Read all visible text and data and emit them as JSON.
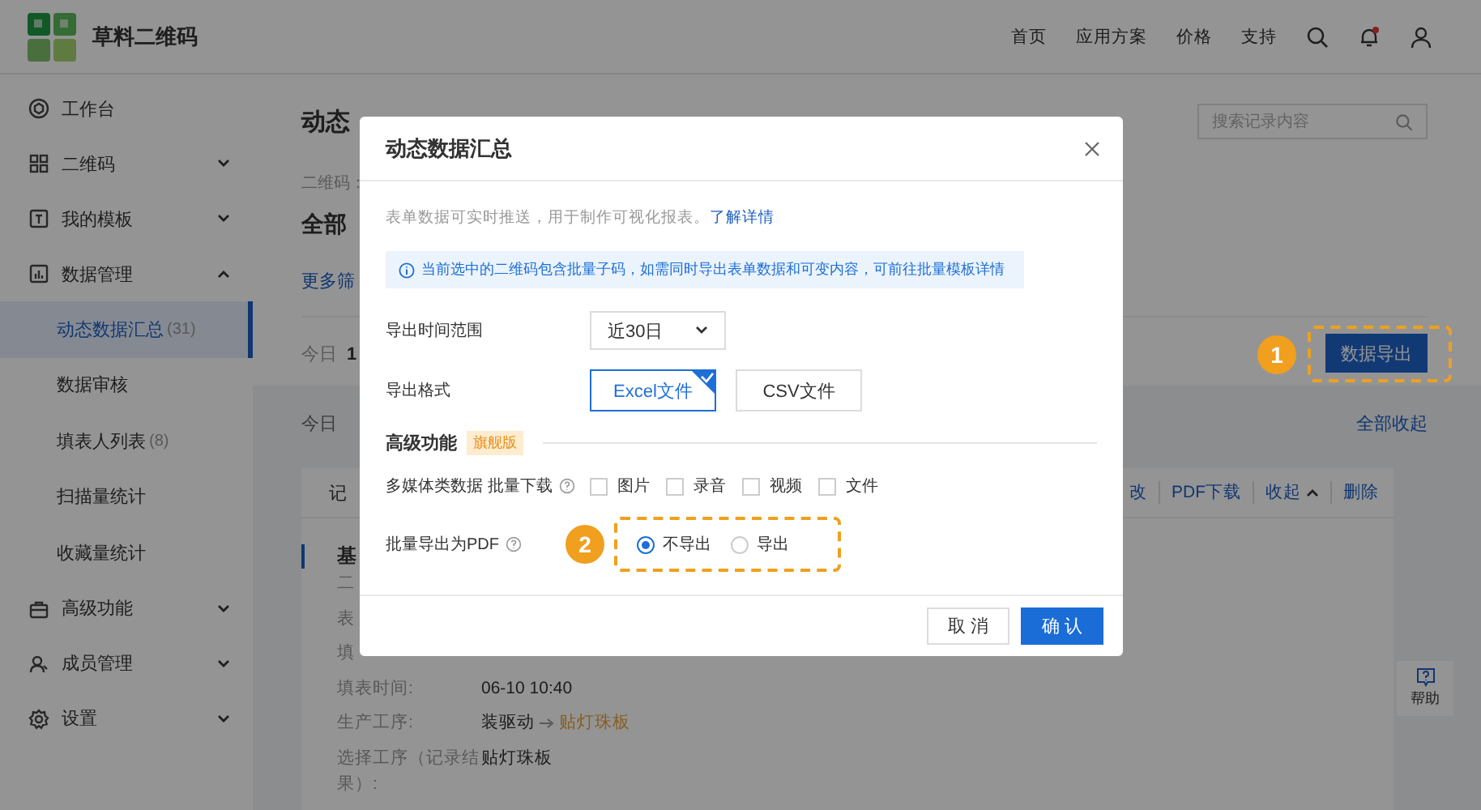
{
  "header": {
    "brand": "草料二维码",
    "nav": [
      "首页",
      "应用方案",
      "价格",
      "支持"
    ]
  },
  "sidebar": {
    "items": [
      {
        "kind": "link",
        "label": "工作台"
      },
      {
        "kind": "group",
        "label": "二维码",
        "expanded": false
      },
      {
        "kind": "group",
        "label": "我的模板",
        "expanded": false
      },
      {
        "kind": "group",
        "label": "数据管理",
        "expanded": true,
        "children": [
          {
            "label": "动态数据汇总",
            "count": "(31)",
            "selected": true
          },
          {
            "label": "数据审核",
            "selected": false
          },
          {
            "label": "填表人列表",
            "count": "(8)",
            "selected": false
          },
          {
            "label": "扫描量统计",
            "selected": false
          },
          {
            "label": "收藏量统计",
            "selected": false
          }
        ]
      },
      {
        "kind": "group",
        "label": "高级功能",
        "expanded": false
      },
      {
        "kind": "group",
        "label": "成员管理",
        "expanded": false
      },
      {
        "kind": "group",
        "label": "设置",
        "expanded": false
      }
    ]
  },
  "page": {
    "title": "动态",
    "search": {
      "placeholder": "搜索记录内容"
    },
    "qr_label": "二维码：",
    "qr_name": "全部",
    "filter_link": "更多筛",
    "today_label": "今日",
    "today_count": "1",
    "export_button": "数据导出",
    "section_label": "今日",
    "collapse_all": "全部收起",
    "record": {
      "header": "记",
      "actions": [
        {
          "label": "改",
          "kind": "link"
        },
        {
          "label": "PDF下载",
          "kind": "link"
        },
        {
          "label": "收起",
          "kind": "dropdown"
        },
        {
          "label": "删除",
          "kind": "link"
        }
      ],
      "section_title": "基",
      "fields": [
        {
          "label": "二"
        },
        {
          "label": "表"
        },
        {
          "label": "填"
        },
        {
          "label": "填表时间:",
          "value": "06-10 10:40"
        },
        {
          "label": "生产工序:",
          "steps": [
            {
              "text": "装驱动",
              "current": false
            },
            {
              "text": "贴灯珠板",
              "current": true
            }
          ]
        },
        {
          "label": "选择工序（记录结果）:",
          "value": "贴灯珠板"
        }
      ]
    }
  },
  "help": {
    "label": "帮助"
  },
  "dialog": {
    "title": "动态数据汇总",
    "intro": "表单数据可实时推送，用于制作可视化报表。",
    "intro_link": "了解详情",
    "notice": "当前选中的二维码包含批量子码，如需同时导出表单数据和可变内容，可前往批量模板详情",
    "time_range": {
      "label": "导出时间范围",
      "value": "近30日"
    },
    "format": {
      "label": "导出格式",
      "options": [
        {
          "label": "Excel文件",
          "selected": true
        },
        {
          "label": "CSV文件",
          "selected": false
        }
      ]
    },
    "advanced": {
      "title": "高级功能",
      "badge": "旗舰版"
    },
    "media": {
      "label": "多媒体类数据 批量下载",
      "options": [
        {
          "label": "图片",
          "checked": false
        },
        {
          "label": "录音",
          "checked": false
        },
        {
          "label": "视频",
          "checked": false
        },
        {
          "label": "文件",
          "checked": false
        }
      ]
    },
    "pdf": {
      "label": "批量导出为PDF",
      "options": [
        {
          "label": "不导出",
          "selected": true
        },
        {
          "label": "导出",
          "selected": false
        }
      ]
    },
    "buttons": [
      {
        "label": "取 消",
        "kind": "secondary"
      },
      {
        "label": "确 认",
        "kind": "primary"
      }
    ]
  },
  "annotations": [
    {
      "label": "1"
    },
    {
      "label": "2"
    }
  ]
}
